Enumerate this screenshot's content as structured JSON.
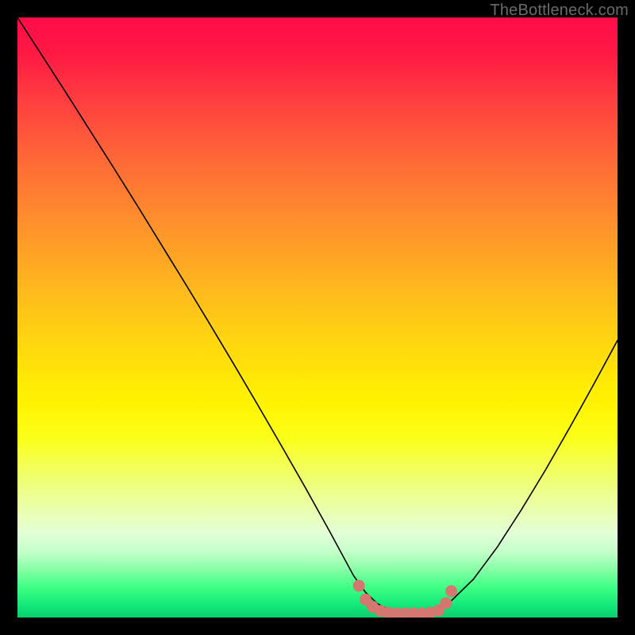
{
  "watermark": "TheBottleneck.com",
  "chart_data": {
    "type": "line",
    "title": "",
    "xlabel": "",
    "ylabel": "",
    "xlim": [
      0,
      100
    ],
    "ylim": [
      0,
      100
    ],
    "grid": false,
    "legend": false,
    "background_gradient": {
      "top_color": "#ff0b48",
      "mid_color": "#fff300",
      "bottom_color": "#0acb6d"
    },
    "series": [
      {
        "name": "bottleneck-curve",
        "stroke": "#000000",
        "x": [
          0,
          4,
          8,
          12,
          16,
          20,
          24,
          28,
          32,
          36,
          40,
          44,
          48,
          52,
          56,
          58,
          60,
          62,
          64,
          66,
          68,
          70,
          72,
          76,
          80,
          84,
          88,
          92,
          96,
          100
        ],
        "y": [
          100,
          93.8,
          87.6,
          81.3,
          75.0,
          68.6,
          62.1,
          55.6,
          49.0,
          42.3,
          35.5,
          28.6,
          21.6,
          14.4,
          7.0,
          4.2,
          2.3,
          1.3,
          1.0,
          1.0,
          1.0,
          1.3,
          2.5,
          6.4,
          11.8,
          18.0,
          24.6,
          31.6,
          38.8,
          46.2
        ]
      },
      {
        "name": "bottleneck-markers",
        "type": "scatter",
        "stroke": "#d3776f",
        "fill": "#d3776f",
        "x": [
          56.9,
          58.0,
          59.2,
          60.5,
          61.8,
          63.2,
          64.6,
          66.0,
          67.4,
          68.8,
          70.2,
          71.4,
          72.3
        ],
        "y": [
          5.3,
          3.0,
          1.8,
          1.1,
          0.8,
          0.7,
          0.7,
          0.7,
          0.7,
          0.8,
          1.2,
          2.4,
          4.4
        ]
      }
    ]
  }
}
